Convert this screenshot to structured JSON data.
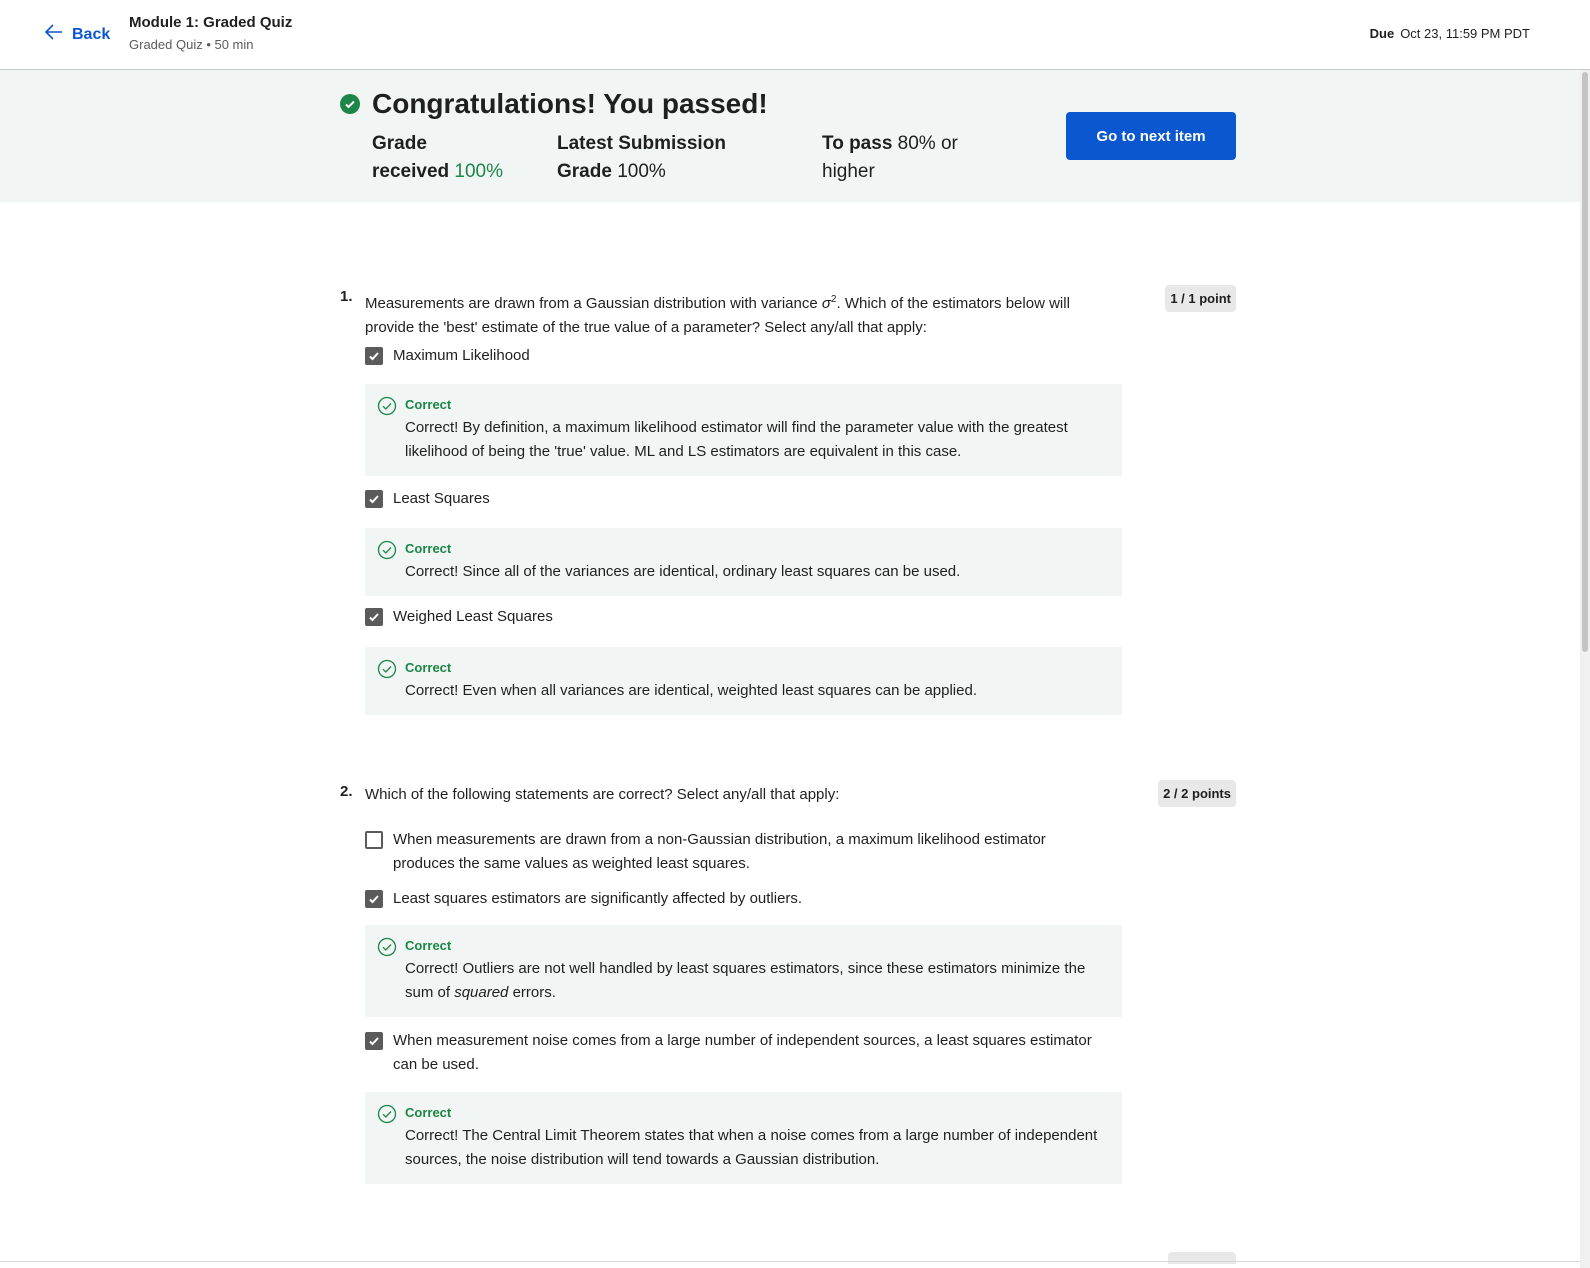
{
  "header": {
    "back_label": "Back",
    "title": "Module 1: Graded Quiz",
    "subtitle": "Graded Quiz • 50 min",
    "due_label": "Due",
    "due_value": "Oct 23, 11:59 PM PDT"
  },
  "banner": {
    "headline": "Congratulations! You passed!",
    "grade_label_1": "Grade",
    "grade_label_2": "received",
    "grade_value": "100%",
    "latest_label_1": "Latest Submission",
    "latest_label_2": "Grade",
    "latest_value": "100%",
    "pass_label": "To pass",
    "pass_value_1": "80% or",
    "pass_value_2": "higher",
    "next_button": "Go to next item"
  },
  "questions": [
    {
      "number": "1.",
      "text_before": "Measurements are drawn from a Gaussian distribution with variance ",
      "symbol": "σ",
      "superscript": "2",
      "text_after": ". Which of the estimators below will provide the 'best' estimate of the true value of a parameter? Select any/all that apply:",
      "points": "1 / 1 point",
      "options": [
        {
          "label": "Maximum Likelihood",
          "checked": true,
          "feedback_label": "Correct",
          "feedback": "Correct! By definition, a maximum likelihood estimator will find the parameter value with the greatest likelihood of being the 'true' value. ML and LS estimators are equivalent in this case."
        },
        {
          "label": "Least Squares",
          "checked": true,
          "feedback_label": "Correct",
          "feedback": "Correct! Since all of the variances are identical, ordinary least squares can be used."
        },
        {
          "label": "Weighed Least Squares",
          "checked": true,
          "feedback_label": "Correct",
          "feedback": "Correct! Even when all variances are identical, weighted least squares can be applied."
        }
      ]
    },
    {
      "number": "2.",
      "text": "Which of the following statements are correct? Select any/all that apply:",
      "points": "2 / 2 points",
      "options": [
        {
          "label": "When measurements are drawn from a non-Gaussian distribution, a maximum likelihood estimator produces the same values as weighted least squares.",
          "checked": false
        },
        {
          "label": "Least squares estimators are significantly affected by outliers.",
          "checked": true,
          "feedback_label": "Correct",
          "feedback_before": "Correct! Outliers are not well handled by least squares estimators, since these estimators minimize the sum of ",
          "feedback_em": "squared",
          "feedback_after": " errors."
        },
        {
          "label": "When measurement noise comes from a large number of independent sources, a least squares estimator can be used.",
          "checked": true,
          "feedback_label": "Correct",
          "feedback": "Correct! The Central Limit Theorem states that when a noise comes from a large number of independent sources, the noise distribution will tend towards a Gaussian distribution."
        }
      ]
    }
  ],
  "colors": {
    "accent": "#0b57d0",
    "success": "#1e8548",
    "banner_bg": "#f1f6f5"
  }
}
